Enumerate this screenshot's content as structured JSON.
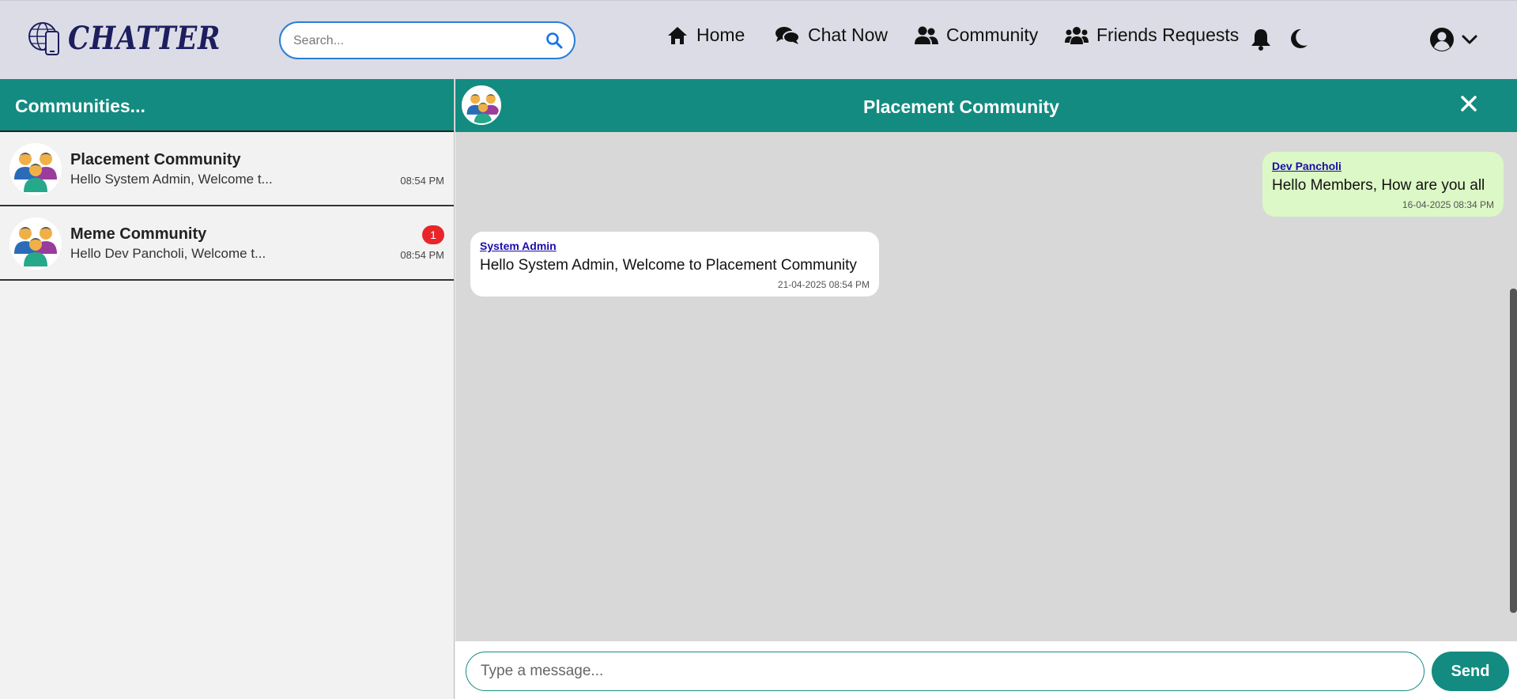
{
  "app": {
    "logo_text": "CHATTER"
  },
  "search": {
    "placeholder": "Search..."
  },
  "nav": {
    "home": "Home",
    "chat_now": "Chat Now",
    "community": "Community",
    "friends_requests": "Friends Requests"
  },
  "sidebar": {
    "title": "Communities...",
    "items": [
      {
        "name": "Placement Community",
        "last_message": "Hello System Admin, Welcome t...",
        "time": "08:54 PM",
        "unread": ""
      },
      {
        "name": "Meme Community",
        "last_message": "Hello Dev Pancholi, Welcome t...",
        "time": "08:54 PM",
        "unread": "1"
      }
    ]
  },
  "chat": {
    "title": "Placement Community",
    "messages": [
      {
        "sender": "Dev Pancholi",
        "text": "Hello Members, How are you all",
        "timestamp": "16-04-2025 08:34 PM",
        "direction": "outgoing"
      },
      {
        "sender": "System Admin",
        "text": "Hello System Admin, Welcome to Placement Community",
        "timestamp": "21-04-2025 08:54 PM",
        "direction": "incoming"
      }
    ],
    "composer_placeholder": "Type a message...",
    "send_label": "Send"
  },
  "colors": {
    "accent": "#138b80",
    "topbar": "#dcdce6",
    "outgoing_bubble": "#dcf8c6",
    "badge": "#e8262a",
    "search_border": "#2a7fd8"
  },
  "icons": [
    "logo-globe-phone-icon",
    "search-icon",
    "home-icon",
    "chat-icon",
    "community-icon",
    "friends-icon",
    "bell-icon",
    "moon-icon",
    "user-circle-icon",
    "chevron-down-icon",
    "close-icon",
    "group-avatar-icon"
  ]
}
